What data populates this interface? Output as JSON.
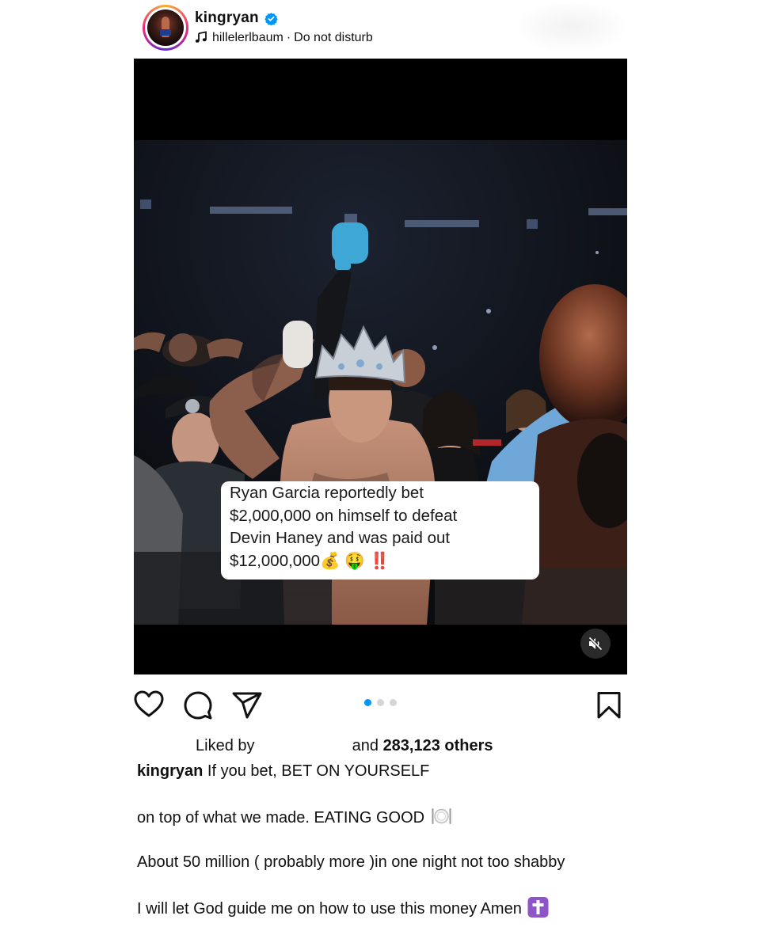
{
  "post": {
    "username": "kingryan",
    "verified": true,
    "audio": {
      "artist": "hillelerlbaum",
      "separator": "·",
      "track": "Do not disturb"
    },
    "media": {
      "overlay_lines": [
        "Ryan Garcia reportedly bet",
        "$2,000,000 on himself to defeat",
        "Devin Haney and was paid out",
        "$12,000,000💰 🤑 ‼️"
      ],
      "carousel": {
        "total": 3,
        "active_index": 0
      },
      "muted": true
    },
    "actions": {
      "icons": [
        "heart-icon",
        "comment-icon",
        "share-icon",
        "bookmark-icon"
      ]
    },
    "likes": {
      "prefix": "Liked by",
      "middle": "and",
      "count_text": "283,123 others"
    },
    "caption": {
      "user": "kingryan",
      "line1": "If you bet, BET ON YOURSELF",
      "line2": "on top of what we made. EATING GOOD",
      "line3": "About 50 million ( probably more )in one night not too shabby",
      "line4": "I will let God guide me on how to use this money Amen"
    },
    "colors": {
      "verified": "#0095f6",
      "active_dot": "#0095f6",
      "inactive_dot": "#d6d6d6"
    }
  }
}
